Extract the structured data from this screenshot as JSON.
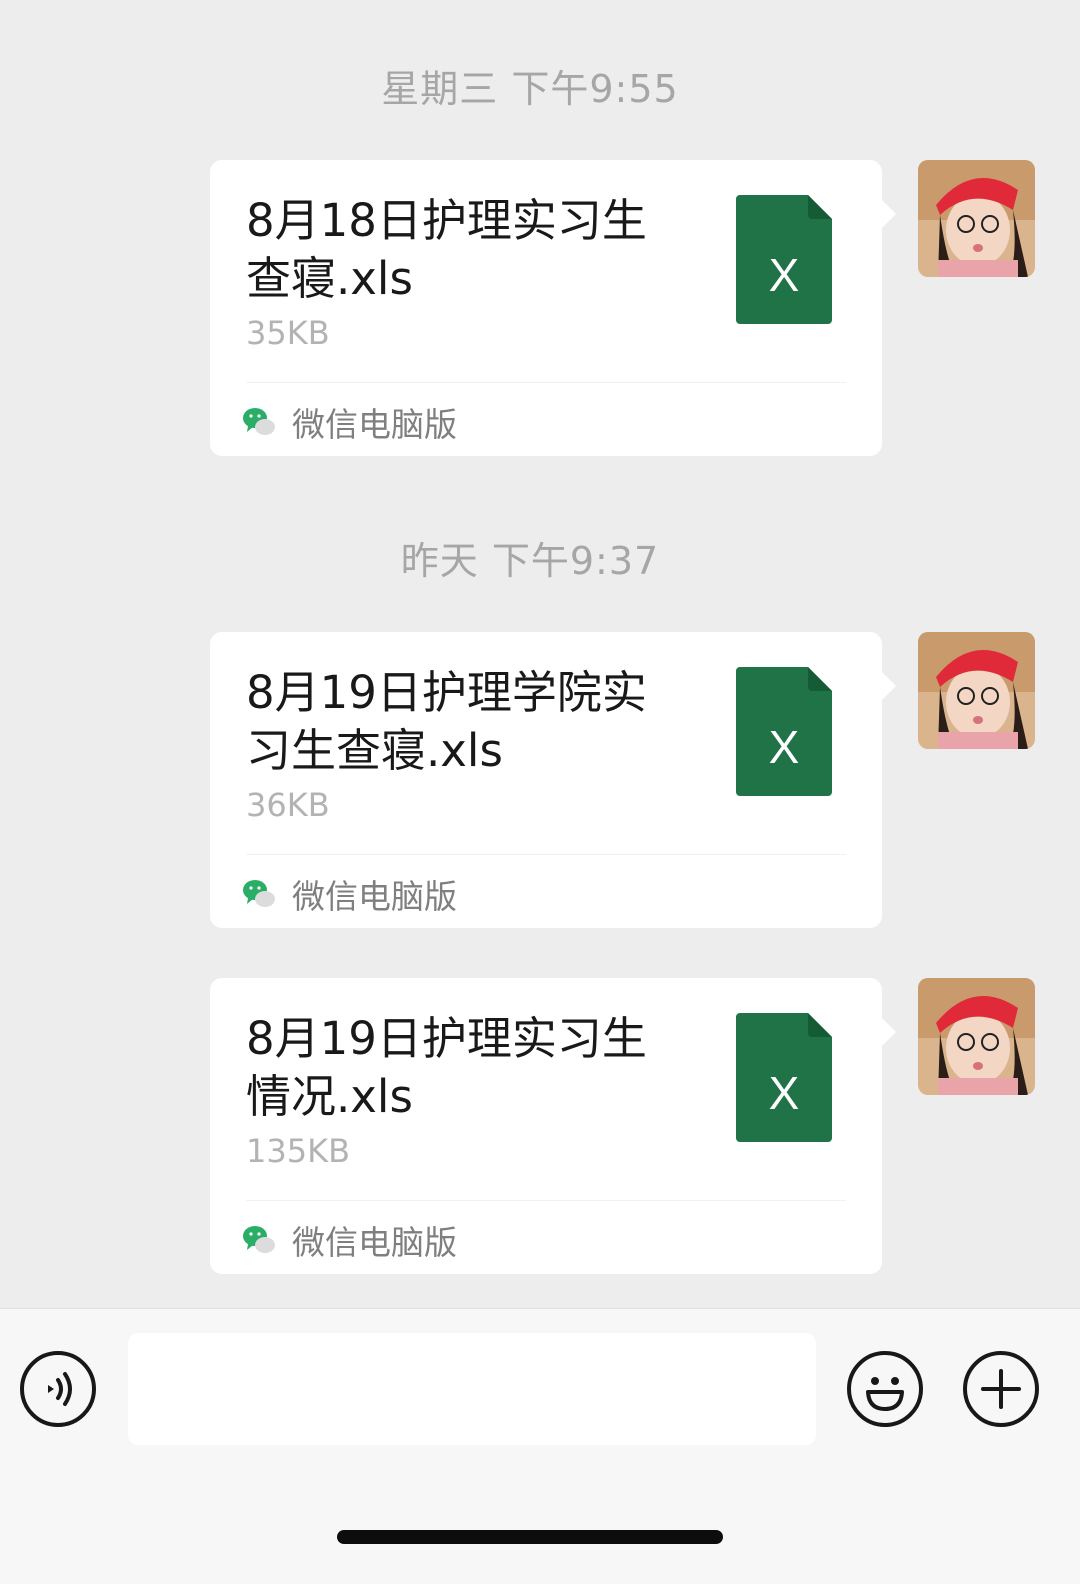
{
  "chat": {
    "timestamps": [
      "星期三 下午9:55",
      "昨天 下午9:37"
    ],
    "messages": [
      {
        "file_name": "8月18日护理实习生查寝.xls",
        "file_size": "35KB",
        "source": "微信电脑版",
        "file_icon": "excel-icon",
        "icon_letter": "X"
      },
      {
        "file_name": "8月19日护理学院实习生查寝.xls",
        "file_size": "36KB",
        "source": "微信电脑版",
        "file_icon": "excel-icon",
        "icon_letter": "X"
      },
      {
        "file_name": "8月19日护理实习生情况.xls",
        "file_size": "135KB",
        "source": "微信电脑版",
        "file_icon": "excel-icon",
        "icon_letter": "X"
      }
    ]
  },
  "input_bar": {
    "voice_icon": "voice-icon",
    "emoji_icon": "emoji-icon",
    "plus_icon": "plus-icon",
    "message_value": ""
  },
  "colors": {
    "background": "#ededed",
    "bubble": "#ffffff",
    "excel_green": "#1f7346",
    "wechat_green": "#2aae67"
  }
}
